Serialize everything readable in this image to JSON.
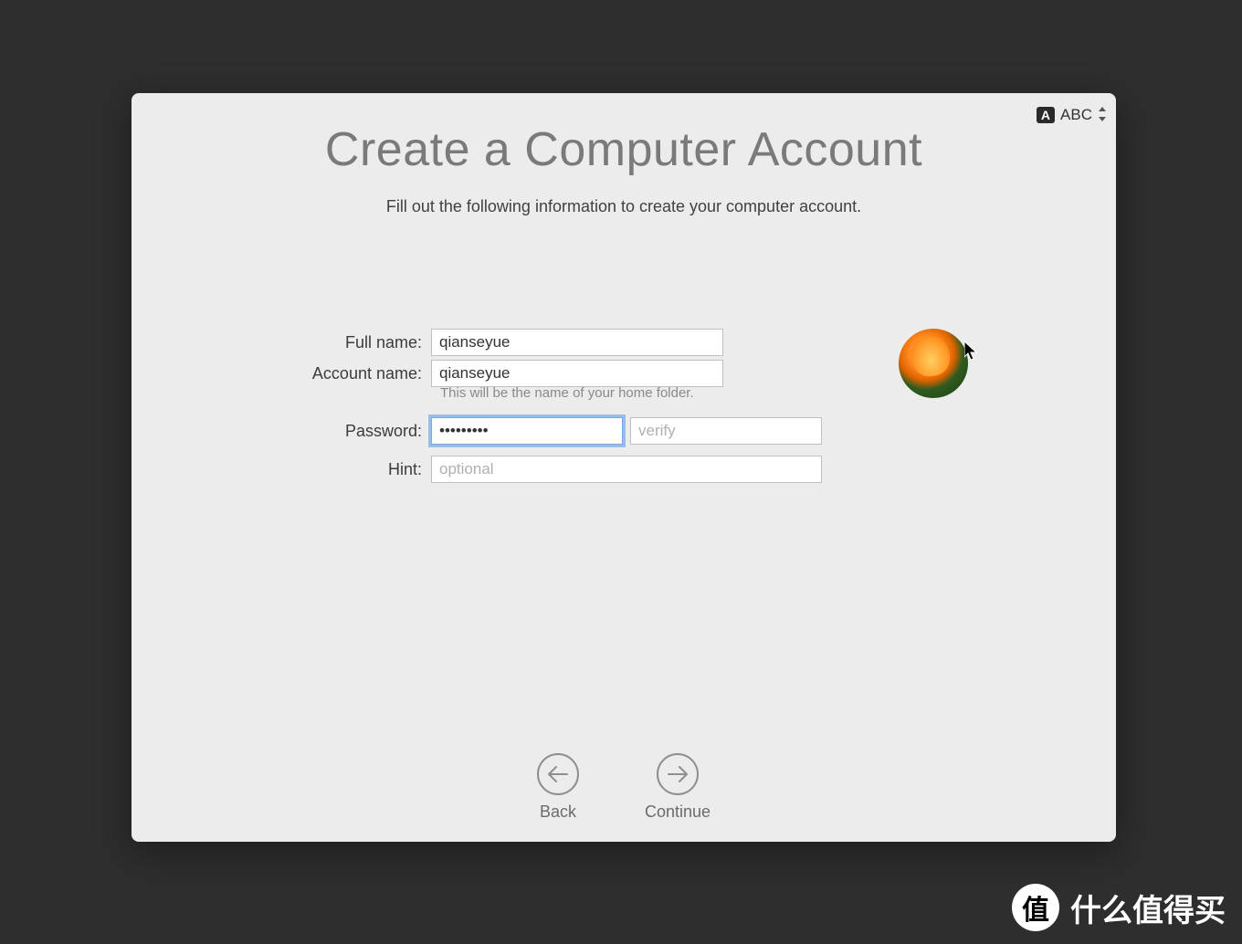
{
  "input_method": {
    "badge": "A",
    "label": "ABC"
  },
  "header": {
    "title": "Create a Computer Account",
    "subtitle": "Fill out the following information to create your computer account."
  },
  "form": {
    "full_name": {
      "label": "Full name:",
      "value": "qianseyue"
    },
    "account_name": {
      "label": "Account name:",
      "value": "qianseyue",
      "hint": "This will be the name of your home folder."
    },
    "password": {
      "label": "Password:",
      "value": "•••••••••",
      "verify_placeholder": "verify"
    },
    "hint": {
      "label": "Hint:",
      "placeholder": "optional"
    }
  },
  "avatar": {
    "name": "flower-avatar"
  },
  "nav": {
    "back": "Back",
    "continue": "Continue"
  },
  "watermark": {
    "badge": "值",
    "text": "什么值得买"
  }
}
